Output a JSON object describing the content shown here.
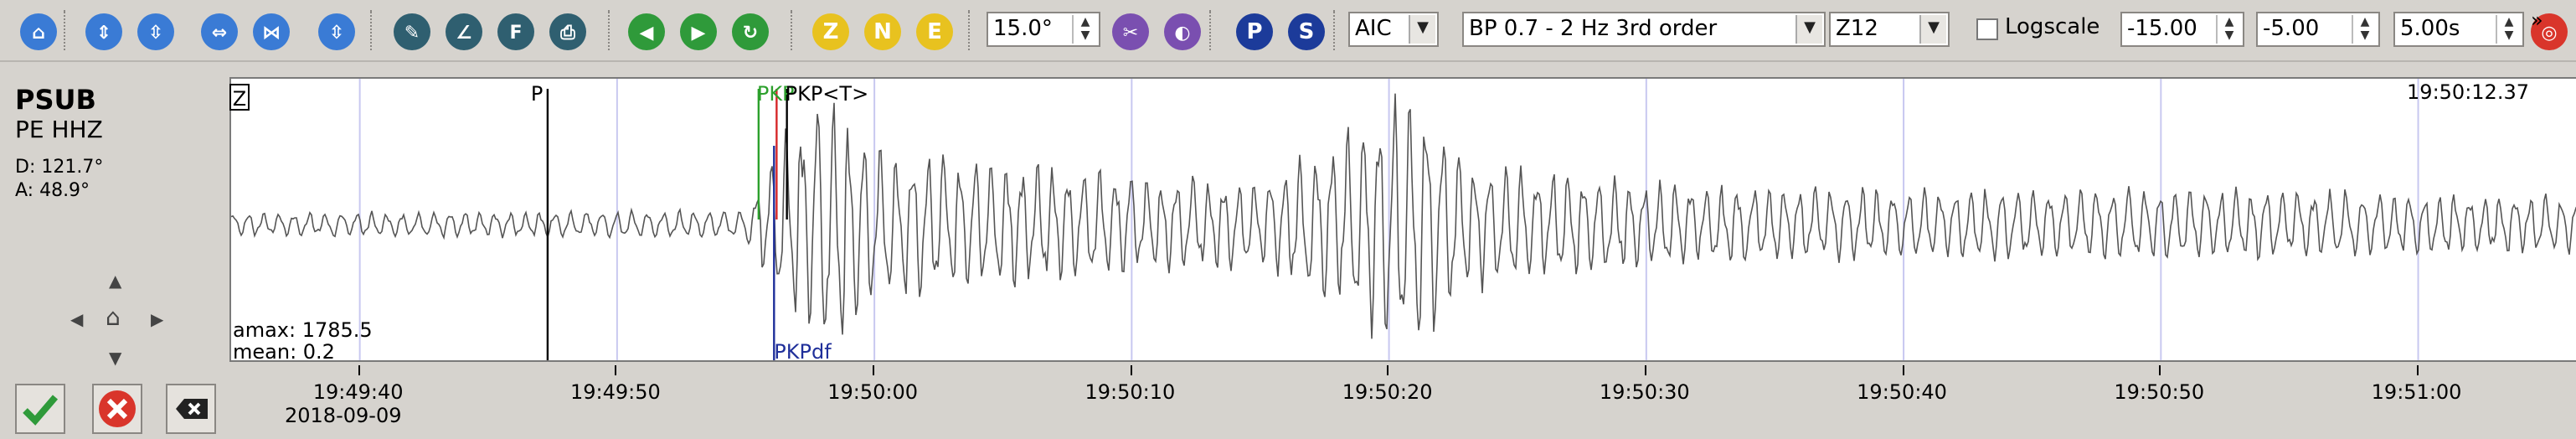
{
  "toolbar": {
    "buttons": [
      {
        "name": "home-icon",
        "color": "#3a7bd5",
        "glyph": "⌂"
      },
      {
        "name": "fit-vertical-icon",
        "color": "#3a7bd5",
        "glyph": "⇕"
      },
      {
        "name": "shrink-vertical-icon",
        "color": "#3a7bd5",
        "glyph": "⇳"
      },
      {
        "name": "fit-horizontal-icon",
        "color": "#3a7bd5",
        "glyph": "⇔"
      },
      {
        "name": "shrink-horizontal-icon",
        "color": "#3a7bd5",
        "glyph": "⋈"
      },
      {
        "name": "scale-vertical-icon",
        "color": "#3a7bd5",
        "glyph": "⇳"
      },
      {
        "name": "pick-pencil-icon",
        "color": "#2f5f70",
        "glyph": "✎"
      },
      {
        "name": "angle-icon",
        "color": "#2f5f70",
        "glyph": "∠"
      },
      {
        "name": "filter-icon",
        "color": "#2f5f70",
        "glyph": "F"
      },
      {
        "name": "printer-icon",
        "color": "#2f5f70",
        "glyph": "⎙"
      },
      {
        "name": "go-left-icon",
        "color": "#2f9a3a",
        "glyph": "◀"
      },
      {
        "name": "go-right-icon",
        "color": "#2f9a3a",
        "glyph": "▶"
      },
      {
        "name": "refresh-icon",
        "color": "#2f9a3a",
        "glyph": "↻"
      }
    ],
    "components": [
      "Z",
      "N",
      "E"
    ],
    "component_color": "#e8c21f",
    "rotation_value": "15.0°",
    "purple_buttons": [
      {
        "name": "edit-filter-icon",
        "color": "#7a4fb0",
        "glyph": "✂"
      },
      {
        "name": "theme-icon",
        "color": "#7a4fb0",
        "glyph": "◐"
      }
    ],
    "phase_buttons": [
      {
        "name": "p-phase-icon",
        "label": "P",
        "color": "#1c3b9a"
      },
      {
        "name": "s-phase-icon",
        "label": "S",
        "color": "#1c3b9a"
      }
    ],
    "picker_method": "AIC",
    "filter": "BP 0.7 - 2 Hz  3rd order",
    "channel": "Z12",
    "logscale_label": "Logscale",
    "logscale_checked": false,
    "min_value": "-15.00",
    "max_value": "-5.00",
    "window_value": "5.00s",
    "more": "»",
    "target_icon_color": "#d9352b"
  },
  "station": {
    "code": "PSUB",
    "net_channel": "PE  HHZ",
    "distance": "D:  121.7°",
    "azimuth": "A:  48.9°"
  },
  "trace": {
    "component_badge": "Z",
    "end_time": "19:50:12.37",
    "amax": "amax: 1785.5",
    "mean": "mean: 0.2"
  },
  "picks": [
    {
      "label": "P",
      "t": 12.3,
      "color": "#000000",
      "pos": "top"
    },
    {
      "label": "PKP",
      "t": 20.5,
      "color": "#2ca02c",
      "pos": "top"
    },
    {
      "label": "PKP<T>",
      "t": 21.6,
      "color": "#000000",
      "pos": "top"
    },
    {
      "label": "",
      "t": 21.2,
      "color": "#d62728",
      "pos": "top"
    },
    {
      "label": "PKPdf",
      "t": 21.1,
      "color": "#1f2f9a",
      "pos": "bottom"
    }
  ],
  "chart_data": {
    "type": "line",
    "title": "",
    "xlabel": "",
    "ylabel": "",
    "x_range_seconds_from_19_49_35": [
      0,
      92.5
    ],
    "grid": "vertical",
    "time_labels": [
      "19:49:40",
      "19:49:50",
      "19:50:00",
      "19:50:10",
      "19:50:20",
      "19:50:30",
      "19:50:40",
      "19:50:50",
      "19:51:00"
    ],
    "date": "2018-09-09",
    "series": [
      {
        "name": "PE HHZ",
        "description": "filtered waveform; low amplitude noise before ~19:50:20, emergent arrivals after, largest burst near 19:50:46",
        "envelope": [
          {
            "t": 0,
            "a": 0.08
          },
          {
            "t": 20,
            "a": 0.1
          },
          {
            "t": 21,
            "a": 0.5
          },
          {
            "t": 23,
            "a": 1.0
          },
          {
            "t": 25,
            "a": 0.55
          },
          {
            "t": 30,
            "a": 0.45
          },
          {
            "t": 35,
            "a": 0.35
          },
          {
            "t": 40,
            "a": 0.3
          },
          {
            "t": 44,
            "a": 0.7
          },
          {
            "t": 46,
            "a": 1.0
          },
          {
            "t": 48,
            "a": 0.45
          },
          {
            "t": 55,
            "a": 0.3
          },
          {
            "t": 62,
            "a": 0.25
          },
          {
            "t": 75,
            "a": 0.25
          },
          {
            "t": 92.5,
            "a": 0.2
          }
        ]
      }
    ]
  },
  "buttons": {
    "accept": "accept-icon",
    "reject": "reject-icon",
    "clear": "clear-icon"
  }
}
